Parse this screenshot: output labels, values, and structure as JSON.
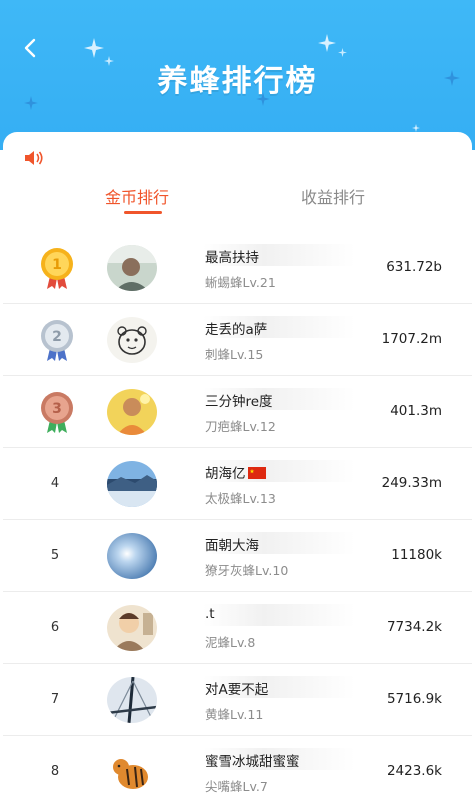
{
  "header": {
    "title": "养蜂排行榜"
  },
  "tabs": [
    {
      "label": "金币排行",
      "active": true
    },
    {
      "label": "收益排行",
      "active": false
    }
  ],
  "colors": {
    "header_blue": "#3fb8f7",
    "accent_orange": "#f0552b"
  },
  "ranking": [
    {
      "rank": "1",
      "medal": "gold-medal-icon",
      "name": "最高扶持",
      "level": "蜥蜴蜂Lv.21",
      "value": "631.72b",
      "avatar": "avatar-photo-1"
    },
    {
      "rank": "2",
      "medal": "silver-medal-icon",
      "name": "走丢的a萨",
      "level": "刺蜂Lv.15",
      "value": "1707.2m",
      "avatar": "avatar-bear-sketch"
    },
    {
      "rank": "3",
      "medal": "bronze-medal-icon",
      "name": "三分钟re度",
      "level": "刀疤蜂Lv.12",
      "value": "401.3m",
      "avatar": "avatar-yellow-photo"
    },
    {
      "rank": "4",
      "name": "胡海亿",
      "flag": "china-flag-icon",
      "level": "太极蜂Lv.13",
      "value": "249.33m",
      "avatar": "avatar-landscape"
    },
    {
      "rank": "5",
      "name": "面朝大海",
      "level": "獠牙灰蜂Lv.10",
      "value": "11180k",
      "avatar": "avatar-sky-sun"
    },
    {
      "rank": "6",
      "name": ".t",
      "level": "泥蜂Lv.8",
      "value": "7734.2k",
      "avatar": "avatar-cartoon-person"
    },
    {
      "rank": "7",
      "name": "对A要不起",
      "level": "黄蜂Lv.11",
      "value": "5716.9k",
      "avatar": "avatar-bridge"
    },
    {
      "rank": "8",
      "name": "蜜雪冰城甜蜜蜜",
      "level": "尖嘴蜂Lv.7",
      "value": "2423.6k",
      "avatar": "avatar-tiger"
    }
  ]
}
